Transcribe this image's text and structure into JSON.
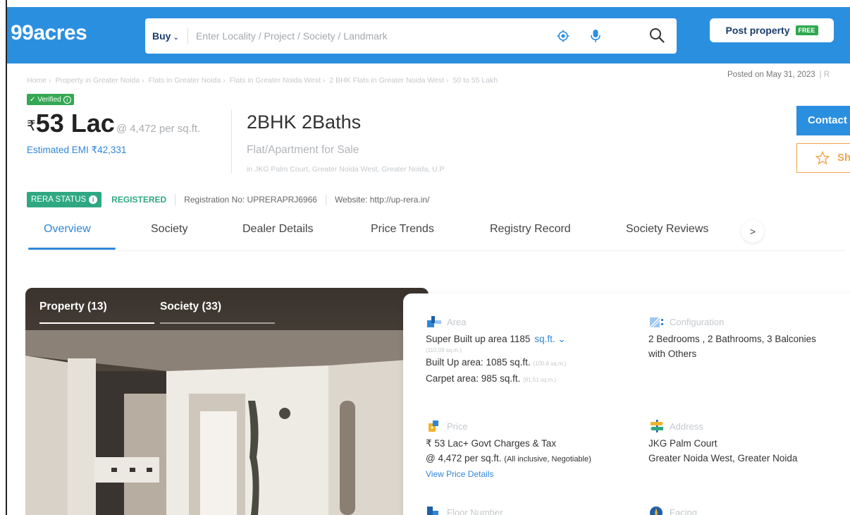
{
  "header": {
    "logo": "99acres",
    "buy_label": "Buy",
    "search_placeholder": "Enter Locality / Project / Society / Landmark",
    "post_property_label": "Post property",
    "free_badge": "FREE"
  },
  "breadcrumb": [
    "Home",
    "Property in Greater Noida",
    "Flats in Greater Noida",
    "Flats in Greater Noida West",
    "2 BHK Flats in Greater Noida West",
    "50 to 55 Lakh"
  ],
  "posted_on": "Posted on May 31, 2023",
  "posted_bar": "| R",
  "verified_label": "Verified",
  "price": {
    "rupee": "₹",
    "value": "53 Lac",
    "per_sqft": "@ 4,472 per sq.ft.",
    "emi": "Estimated EMI ₹42,331"
  },
  "listing": {
    "title": "2BHK 2Baths",
    "subtitle": "Flat/Apartment for Sale",
    "location": "in JKG Palm Court, Greater Noida West, Greater Noida, U.P"
  },
  "actions": {
    "contact_label": "Contact",
    "shortlist_label": "Sh"
  },
  "rera": {
    "status_label": "RERA STATUS",
    "status_value": "REGISTERED",
    "registration": "Registration No: UPRERAPRJ6966",
    "website": "Website: http://up-rera.in/"
  },
  "tabs": [
    "Overview",
    "Society",
    "Dealer Details",
    "Price Trends",
    "Registry Record",
    "Society Reviews"
  ],
  "tab_next": ">",
  "gallery": {
    "tabs": [
      "Property (13)",
      "Society (33)"
    ]
  },
  "details": {
    "area": {
      "label": "Area",
      "super_built": "Super Built up area 1185",
      "unit": "sq.ft.",
      "super_built_sqm": "(110.09 sq.m.)",
      "built_up": "Built Up area: 1085 sq.ft.",
      "built_up_sqm": "(100.8 sq.m.)",
      "carpet": "Carpet area: 985 sq.ft.",
      "carpet_sqm": "(91.51 sq.m.)"
    },
    "configuration": {
      "label": "Configuration",
      "line1": "2 Bedrooms , 2 Bathrooms, 3 Balconies",
      "line2": "with Others"
    },
    "price": {
      "label": "Price",
      "line1": "₹ 53 Lac+ Govt Charges & Tax",
      "line2": "@ 4,472 per sq.ft.",
      "line2_note": "(All inclusive, Negotiable)",
      "link": "View Price Details"
    },
    "address": {
      "label": "Address",
      "line1": "JKG Palm Court",
      "line2": "Greater Noida West, Greater Noida"
    },
    "floor": {
      "label": "Floor Number"
    },
    "facing": {
      "label": "Facing"
    }
  },
  "colors": {
    "brand_blue": "#2b8fe0",
    "link_blue": "#2f86d9",
    "rera_green": "#2fa882",
    "verified_green": "#34a853",
    "shortlist_orange": "#f1a54a"
  }
}
